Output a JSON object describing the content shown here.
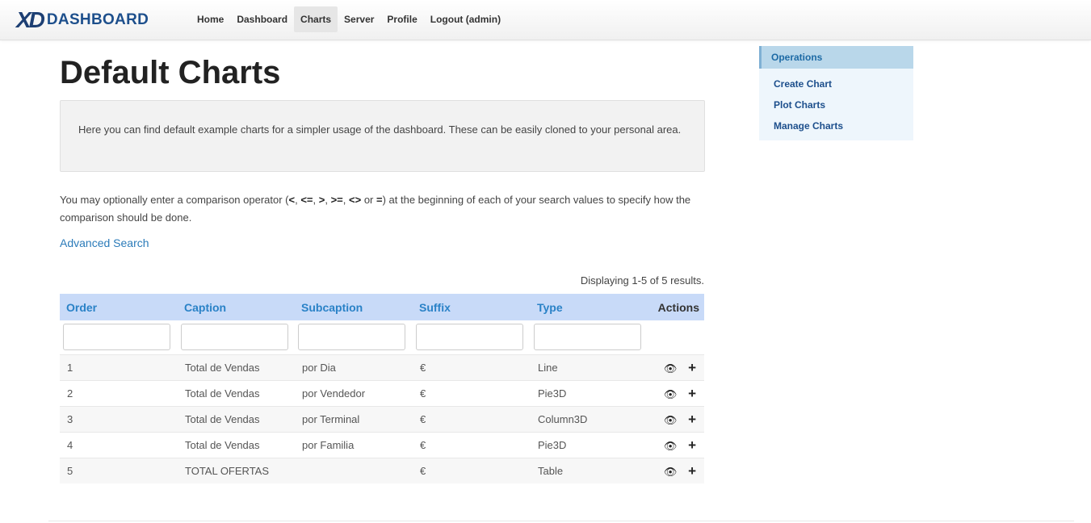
{
  "brand": {
    "mark": "XD",
    "text": "DASHBOARD"
  },
  "nav": {
    "items": [
      {
        "label": "Home"
      },
      {
        "label": "Dashboard"
      },
      {
        "label": "Charts"
      },
      {
        "label": "Server"
      },
      {
        "label": "Profile"
      },
      {
        "label": "Logout (admin)"
      }
    ],
    "active": "Charts"
  },
  "page": {
    "title": "Default Charts",
    "intro": "Here you can find default example charts for a simpler usage of the dashboard. These can be easily cloned to your personal area.",
    "hint_before": "You may optionally enter a comparison operator (",
    "hint_operators": [
      "<",
      "<=",
      ">",
      ">=",
      "<>",
      "="
    ],
    "hint_after": ") at the beginning of each of your search values to specify how the comparison should be done.",
    "advanced_search": "Advanced Search",
    "summary": "Displaying 1-5 of 5 results."
  },
  "grid": {
    "columns": [
      "Order",
      "Caption",
      "Subcaption",
      "Suffix",
      "Type",
      "Actions"
    ],
    "filters": [
      "",
      "",
      "",
      "",
      ""
    ],
    "rows": [
      [
        "1",
        "Total de Vendas",
        "por Dia",
        "€",
        "Line"
      ],
      [
        "2",
        "Total de Vendas",
        "por Vendedor",
        "€",
        "Pie3D"
      ],
      [
        "3",
        "Total de Vendas",
        "por Terminal",
        "€",
        "Column3D"
      ],
      [
        "4",
        "Total de Vendas",
        "por Familia",
        "€",
        "Pie3D"
      ],
      [
        "5",
        "TOTAL OFERTAS",
        "",
        "€",
        "Table"
      ]
    ],
    "row_actions": [
      {
        "icon": "eye-icon",
        "glyph": "👁"
      },
      {
        "icon": "plus-icon",
        "glyph": "+"
      }
    ]
  },
  "sidebar": {
    "title": "Operations",
    "links": [
      "Create Chart",
      "Plot Charts",
      "Manage Charts"
    ]
  },
  "colors": {
    "brand": "#1d4f8c",
    "header_bg": "#c8daf8",
    "link": "#2b7bb9",
    "sidebar_bg": "#eef6fc"
  }
}
